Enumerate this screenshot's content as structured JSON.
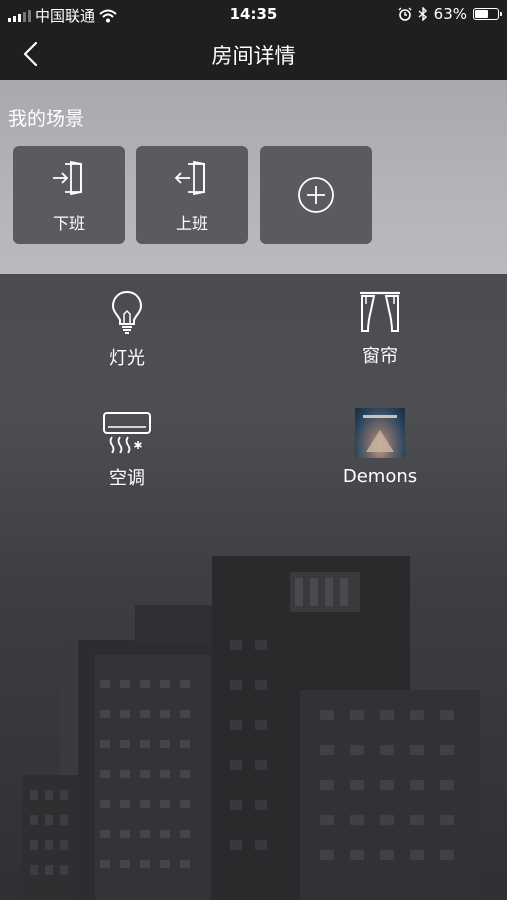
{
  "status_bar": {
    "carrier": "中国联通",
    "time": "14:35",
    "battery_percent": "63%",
    "battery_level": 0.63,
    "icons": [
      "signal-icon",
      "wifi-icon",
      "alarm-icon",
      "bluetooth-icon",
      "battery-icon"
    ]
  },
  "nav": {
    "title": "房间详情",
    "back_icon": "chevron-left-icon"
  },
  "scenes": {
    "heading": "我的场景",
    "items": [
      {
        "label": "下班",
        "icon": "door-enter-icon"
      },
      {
        "label": "上班",
        "icon": "door-exit-icon"
      },
      {
        "label": "",
        "icon": "add-circle-icon"
      }
    ]
  },
  "devices": [
    {
      "label": "灯光",
      "icon": "light-bulb-icon"
    },
    {
      "label": "窗帘",
      "icon": "curtain-icon"
    },
    {
      "label": "空调",
      "icon": "air-conditioner-icon"
    },
    {
      "label": "Demons",
      "icon": "album-cover-icon"
    }
  ],
  "colors": {
    "bar_bg": "#1f1f1f",
    "scene_panel_bg": "#b3b5b9",
    "scene_card_bg": "#5a5b5e",
    "text": "#ffffff"
  }
}
